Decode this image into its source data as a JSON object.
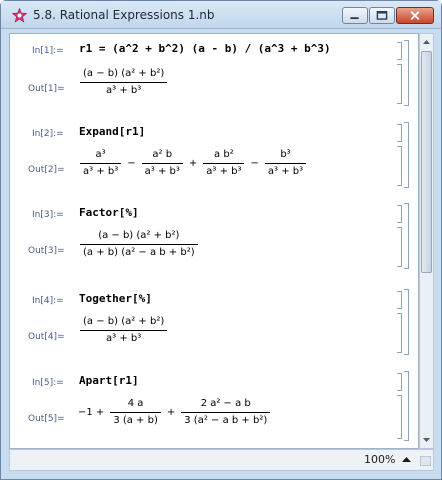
{
  "window": {
    "title": "5.8. Rational Expressions 1.nb",
    "zoom": "100%",
    "title_icon_color": "#d9367a"
  },
  "cells": [
    {
      "in_label": "In[1]:=",
      "input": "r1 = (a^2 + b^2) (a - b) / (a^3 + b^3)",
      "out_label": "Out[1]=",
      "output": {
        "num": "(a − b) (a² + b²)",
        "den": "a³ + b³"
      }
    },
    {
      "in_label": "In[2]:=",
      "input": "Expand[r1]",
      "out_label": "Out[2]=",
      "output": {
        "terms": [
          {
            "num": "a³",
            "den": "a³ + b³"
          },
          {
            "num": "a² b",
            "den": "a³ + b³"
          },
          {
            "num": "a b²",
            "den": "a³ + b³"
          },
          {
            "num": "b³",
            "den": "a³ + b³"
          }
        ],
        "ops": [
          "−",
          "+",
          "−"
        ]
      }
    },
    {
      "in_label": "In[3]:=",
      "input": "Factor[%]",
      "out_label": "Out[3]=",
      "output": {
        "num": "(a − b) (a² + b²)",
        "den": "(a + b) (a² − a b + b²)"
      }
    },
    {
      "in_label": "In[4]:=",
      "input": "Together[%]",
      "out_label": "Out[4]=",
      "output": {
        "num": "(a − b) (a² + b²)",
        "den": "a³ + b³"
      }
    },
    {
      "in_label": "In[5]:=",
      "input": "Apart[r1]",
      "out_label": "Out[5]=",
      "output": {
        "lead": "−1 +",
        "terms": [
          {
            "num": "4 a",
            "den": "3 (a + b)"
          },
          {
            "num": "2 a² − a b",
            "den": "3 (a² − a b + b²)"
          }
        ],
        "ops": [
          "+"
        ]
      }
    }
  ]
}
